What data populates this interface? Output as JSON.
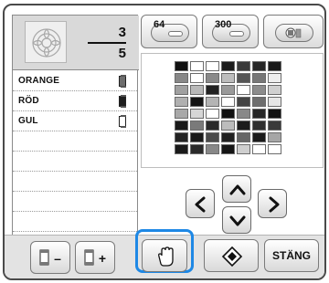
{
  "counter": {
    "current": "3",
    "total": "5"
  },
  "threads": [
    {
      "label": "ORANGE",
      "spool_color": "#6d6d6d"
    },
    {
      "label": "RÖD",
      "spool_color": "#1f1f1f"
    },
    {
      "label": "GUL",
      "spool_color": "#ffffff"
    },
    {
      "label": "",
      "spool_color": ""
    },
    {
      "label": "",
      "spool_color": ""
    },
    {
      "label": "",
      "spool_color": ""
    },
    {
      "label": "",
      "spool_color": ""
    },
    {
      "label": "",
      "spool_color": ""
    }
  ],
  "top_buttons": {
    "palette64": "64",
    "palette300": "300",
    "custom_palette_icon": "spool-palette-icon"
  },
  "color_grid": [
    [
      "#111111",
      "#ffffff",
      "#ffffff",
      "#1a1a1a",
      "#3a3a3a",
      "#262626",
      "#1a1a1a"
    ],
    [
      "#888888",
      "#ffffff",
      "#8a8a8a",
      "#bdbdbd",
      "#555555",
      "#777777",
      "#eeeeee"
    ],
    [
      "#a0a0a0",
      "#b8b8b8",
      "#222222",
      "#9a9a9a",
      "#ffffff",
      "#8c8c8c",
      "#d0d0d0"
    ],
    [
      "#b0b0b0",
      "#141414",
      "#b4b4b4",
      "#ffffff",
      "#444444",
      "#6e6e6e",
      "#e6e6e6"
    ],
    [
      "#a8a8a8",
      "#d6d6d6",
      "#ffffff",
      "#101010",
      "#888888",
      "#262626",
      "#111111"
    ],
    [
      "#1a1a1a",
      "#7a7a7a",
      "#2a2a2a",
      "#bcbcbc",
      "#1c1c1c",
      "#2e2e2e",
      "#3a3a3a"
    ],
    [
      "#222222",
      "#1a1a1a",
      "#4a4a4a",
      "#202020",
      "#666666",
      "#1a1a1a",
      "#a6a6a6"
    ],
    [
      "#1a1a1a",
      "#2a2a2a",
      "#888888",
      "#151515",
      "#cfcfcf",
      "#ffffff",
      "#ffffff"
    ]
  ],
  "bottom": {
    "remove_spool_label": "–",
    "add_spool_label": "+",
    "hand_icon": "hand-icon",
    "fill_icon": "diamond-arrows-icon",
    "close_label": "STÄNG"
  },
  "colors": {
    "accent": "#1e88e5"
  }
}
